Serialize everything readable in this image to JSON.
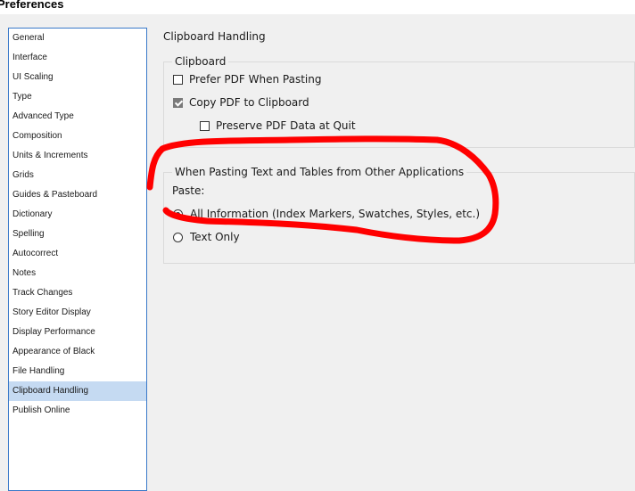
{
  "window": {
    "title": "Preferences"
  },
  "sidebar": {
    "items": [
      {
        "label": "General"
      },
      {
        "label": "Interface"
      },
      {
        "label": "UI Scaling"
      },
      {
        "label": "Type"
      },
      {
        "label": "Advanced Type"
      },
      {
        "label": "Composition"
      },
      {
        "label": "Units & Increments"
      },
      {
        "label": "Grids"
      },
      {
        "label": "Guides & Pasteboard"
      },
      {
        "label": "Dictionary"
      },
      {
        "label": "Spelling"
      },
      {
        "label": "Autocorrect"
      },
      {
        "label": "Notes"
      },
      {
        "label": "Track Changes"
      },
      {
        "label": "Story Editor Display"
      },
      {
        "label": "Display Performance"
      },
      {
        "label": "Appearance of Black"
      },
      {
        "label": "File Handling"
      },
      {
        "label": "Clipboard Handling"
      },
      {
        "label": "Publish Online"
      }
    ],
    "selected": "Clipboard Handling"
  },
  "main": {
    "title": "Clipboard Handling",
    "clipboard_group": {
      "title": "Clipboard",
      "prefer_pdf": {
        "label": "Prefer PDF When Pasting",
        "checked": false
      },
      "copy_pdf": {
        "label": "Copy PDF to Clipboard",
        "checked": true
      },
      "preserve_pdf": {
        "label": "Preserve PDF Data at Quit",
        "checked": false
      }
    },
    "pasting_group": {
      "title": "When Pasting Text and Tables from Other Applications",
      "paste_label": "Paste:",
      "all_information": {
        "label": "All Information (Index Markers, Swatches, Styles, etc.)",
        "selected": true
      },
      "text_only": {
        "label": "Text Only",
        "selected": false
      }
    }
  },
  "annotation": {
    "color": "#ff0000"
  }
}
